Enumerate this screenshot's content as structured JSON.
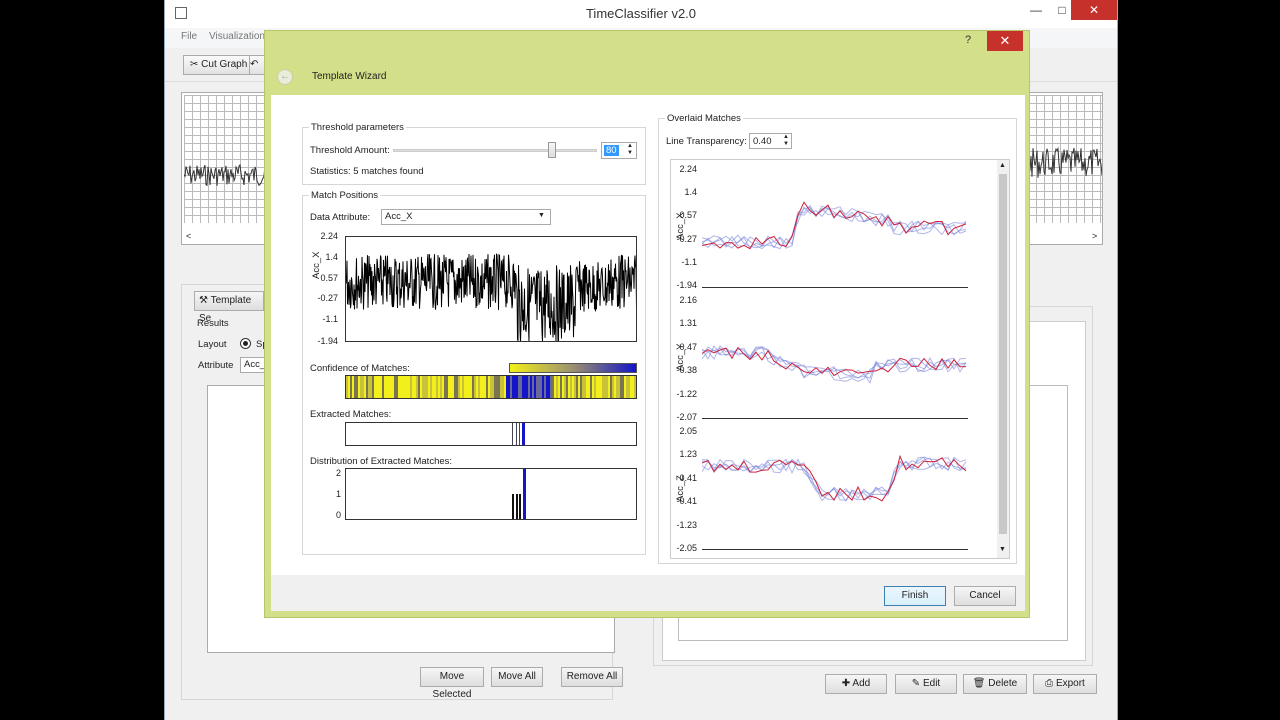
{
  "app": {
    "title": "TimeClassifier v2.0",
    "menu": [
      "File",
      "Visualization"
    ],
    "toolbar": {
      "cut_graph": "Cut Graph",
      "cut_icon": "scissors-icon"
    },
    "window_controls": {
      "minimize": "—",
      "maximize": "□",
      "close": "✕"
    },
    "graph_scroll": {
      "left": "<",
      "right": ">"
    }
  },
  "left_panel": {
    "tab": "Template Se",
    "results_label": "Results",
    "layout_label": "Layout",
    "layout_option": "Sp",
    "attribute_label": "Attribute",
    "attribute_value": "Acc_",
    "buttons": {
      "move_selected": "Move Selected",
      "move_all": "Move All",
      "remove_all": "Remove All"
    }
  },
  "right_panel": {
    "buttons": {
      "add": "Add",
      "edit": "Edit",
      "delete": "Delete",
      "export": "Export"
    }
  },
  "dialog": {
    "title": "Template Wizard",
    "help": "?",
    "close": "✕",
    "back": "←",
    "threshold": {
      "group_title": "Threshold parameters",
      "amount_label": "Threshold Amount:",
      "amount_value": "80",
      "slider_fraction": 0.78,
      "statistics": "Statistics: 5 matches found"
    },
    "match_positions": {
      "group_title": "Match Positions",
      "attribute_label": "Data Attribute:",
      "attribute_value": "Acc_X",
      "y_label": "Acc_X",
      "y_ticks": [
        "2.24",
        "1.4",
        "0.57",
        "-0.27",
        "-1.1",
        "-1.94"
      ],
      "confidence_label": "Confidence of Matches:",
      "extracted_label": "Extracted Matches:",
      "distribution_label": "Distribution of Extracted Matches:",
      "distribution_ticks": [
        "2",
        "1",
        "0"
      ],
      "confidence_colors": {
        "low": "#f2ef1a",
        "high": "#1414c8"
      }
    },
    "overlaid": {
      "group_title": "Overlaid Matches",
      "transparency_label": "Line Transparency:",
      "transparency_value": "0.40",
      "plots": [
        {
          "y_label": "Acc_X",
          "y_ticks": [
            "2.24",
            "1.4",
            "0.57",
            "-0.27",
            "-1.1",
            "-1.94"
          ]
        },
        {
          "y_label": "Acc_Y",
          "y_ticks": [
            "2.16",
            "1.31",
            "0.47",
            "-0.38",
            "-1.22",
            "-2.07"
          ]
        },
        {
          "y_label": "Acc_Z",
          "y_ticks": [
            "2.05",
            "1.23",
            "0.41",
            "-0.41",
            "-1.23",
            "-2.05"
          ]
        }
      ],
      "colors": {
        "highlight": "#d0203a",
        "match": "#7a86d8"
      }
    },
    "finish": "Finish",
    "cancel": "Cancel"
  }
}
